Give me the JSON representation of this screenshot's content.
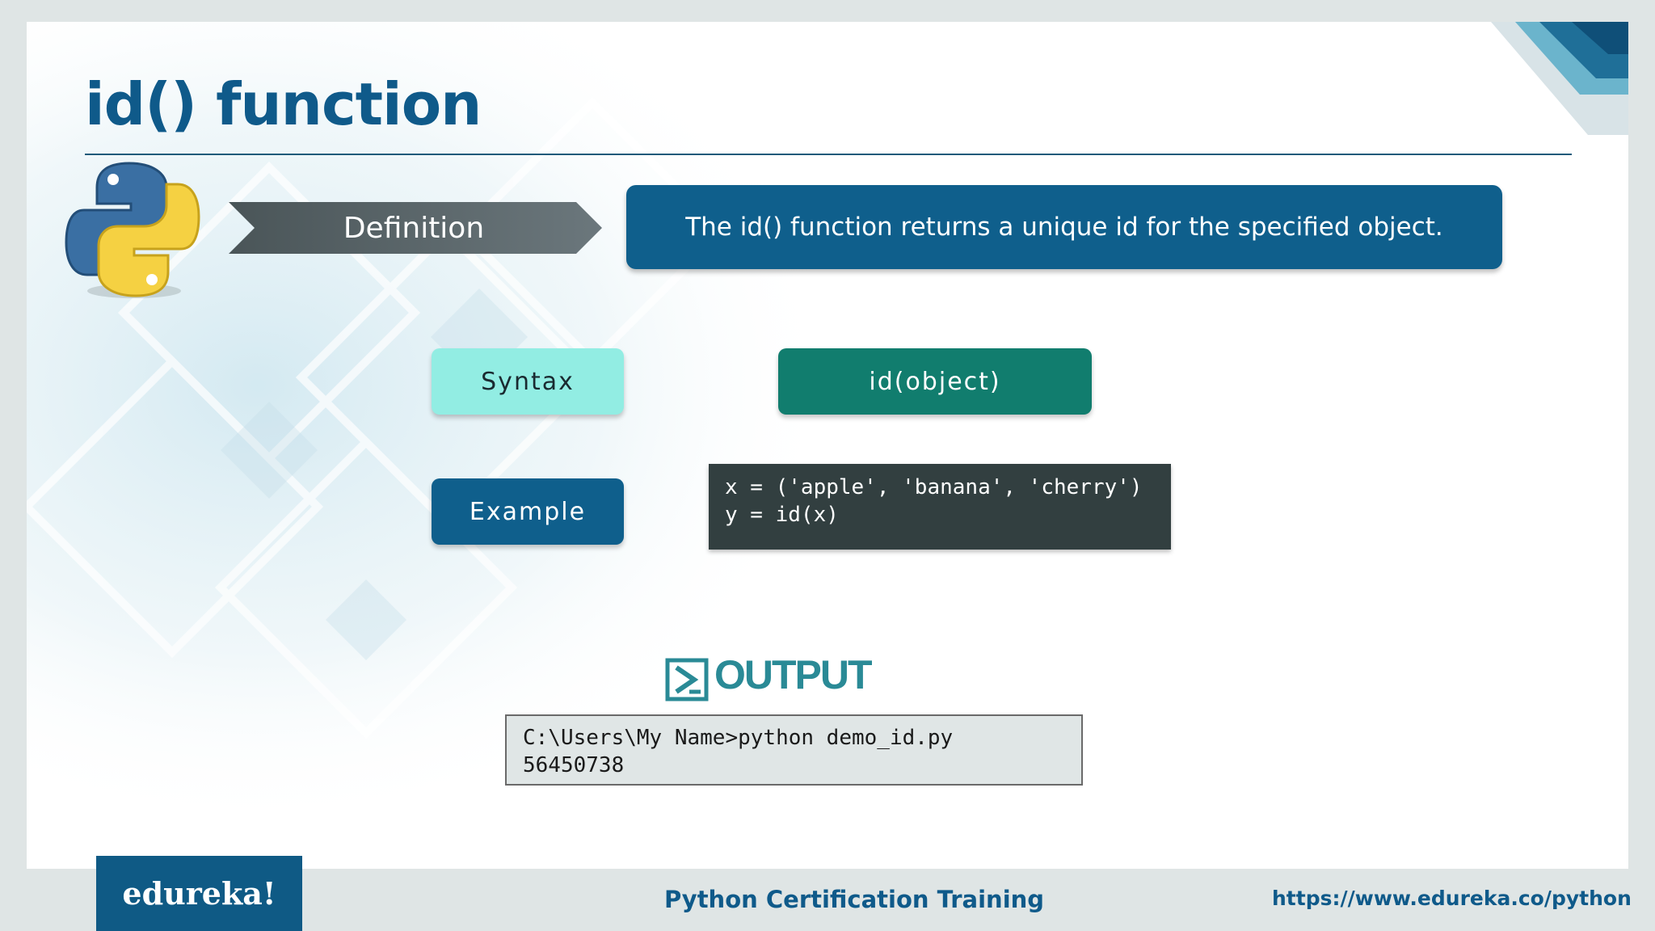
{
  "slide": {
    "title": "id() function",
    "definition_label": "Definition",
    "definition_text": "The id() function returns a unique id for the specified object.",
    "syntax_label": "Syntax",
    "syntax_value": "id(object)",
    "example_label": "Example",
    "example_code": [
      "x = ('apple', 'banana', 'cherry')",
      "y = id(x)"
    ],
    "output_heading": "OUTPUT",
    "output_lines": [
      "C:\\Users\\My Name>python demo_id.py",
      "56450738"
    ]
  },
  "footer": {
    "brand": "edureka!",
    "course": "Python Certification Training",
    "url": "https://www.edureka.co/python"
  },
  "icons": {
    "logo": "python-logo-icon",
    "output": "output-play-icon"
  },
  "colors": {
    "primary_blue": "#0f5f8c",
    "teal": "#117d6e",
    "mint": "#92ede3",
    "code_bg": "#323f40",
    "arrow_gray": "#5f6b70"
  }
}
